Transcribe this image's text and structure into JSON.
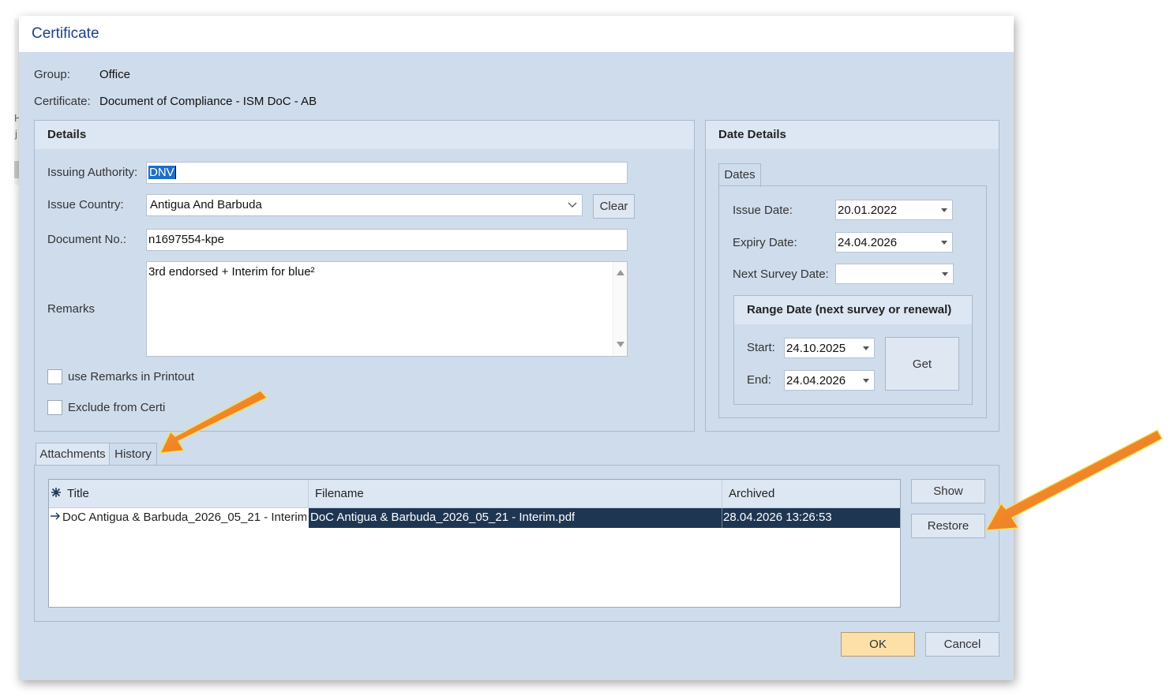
{
  "dialog": {
    "title": "Certificate",
    "group_label": "Group:",
    "group_value": "Office",
    "certificate_label": "Certificate:",
    "certificate_value": "Document of Compliance - ISM DoC - AB"
  },
  "details": {
    "header": "Details",
    "issuing_authority_label": "Issuing Authority:",
    "issuing_authority_value": "DNV",
    "issue_country_label": "Issue Country:",
    "issue_country_value": "Antigua And Barbuda",
    "clear_label": "Clear",
    "document_no_label": "Document No.:",
    "document_no_value": "n1697554-kpe",
    "remarks_label": "Remarks",
    "remarks_value": "3rd endorsed + Interim for blue²",
    "use_remarks_label": "use Remarks in Printout",
    "exclude_label": "Exclude from Certi"
  },
  "date_details": {
    "header": "Date Details",
    "tab_label": "Dates",
    "issue_date_label": "Issue Date:",
    "issue_date_value": "20.01.2022",
    "expiry_date_label": "Expiry Date:",
    "expiry_date_value": "24.04.2026",
    "next_survey_label": "Next Survey Date:",
    "next_survey_value": "",
    "range": {
      "header": "Range Date (next survey or renewal)",
      "start_label": "Start:",
      "start_value": "24.10.2025",
      "end_label": "End:",
      "end_value": "24.04.2026",
      "get_label": "Get"
    }
  },
  "bottom_tabs": [
    "Attachments",
    "History"
  ],
  "history_table": {
    "columns": [
      "Title",
      "Filename",
      "Archived"
    ],
    "rows": [
      {
        "title": "DoC Antigua & Barbuda_2026_05_21 - Interim",
        "filename": "DoC Antigua & Barbuda_2026_05_21 - Interim.pdf",
        "archived": "28.04.2026 13:26:53"
      }
    ]
  },
  "side_buttons": {
    "show": "Show",
    "restore": "Restore"
  },
  "footer": {
    "ok": "OK",
    "cancel": "Cancel"
  },
  "colors": {
    "dialog_bg": "#cfdcec",
    "title_text": "#1f3f8f",
    "selection": "#1f3653",
    "ok_button": "#fde0a8",
    "annotation_arrow": "#f5821f"
  },
  "icons": [
    "mouse-cursor-icon",
    "chevron-down-icon",
    "scroll-up-icon",
    "scroll-down-icon",
    "new-row-star-icon",
    "row-pointer-icon",
    "annotation-arrow"
  ]
}
